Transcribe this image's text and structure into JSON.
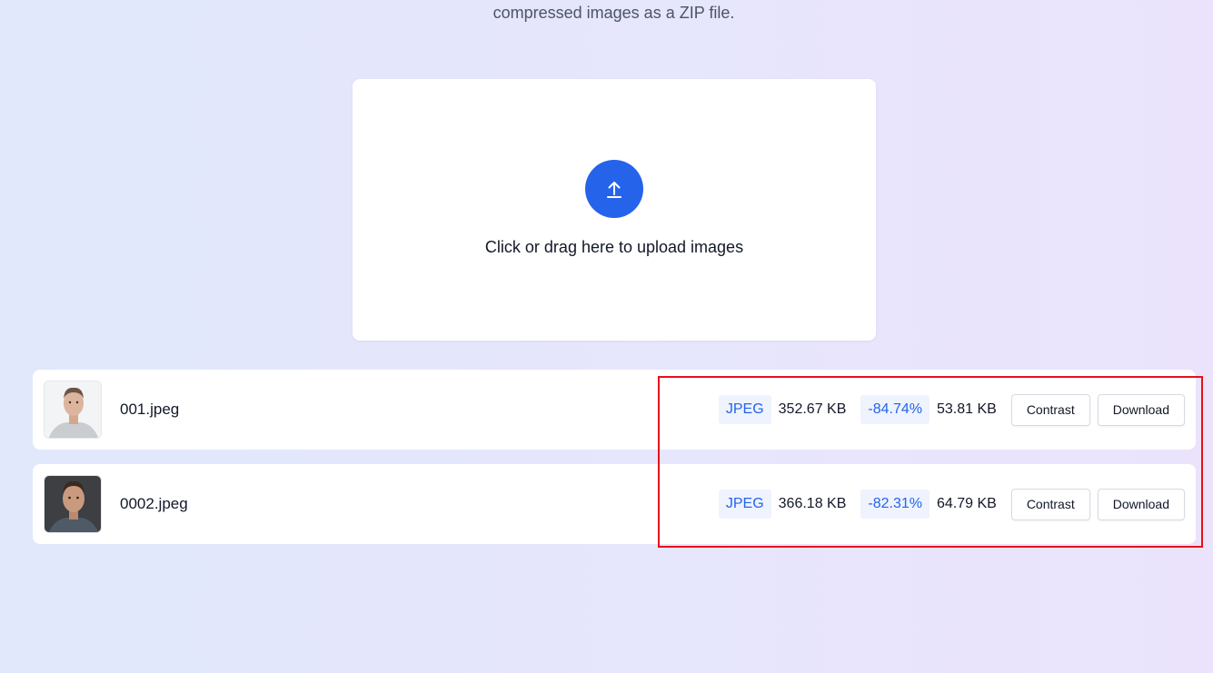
{
  "header": {
    "subtitle": "compressed images as a ZIP file."
  },
  "upload": {
    "icon": "upload-arrow-icon",
    "text": "Click or drag here to upload images",
    "accent_color": "#2563eb"
  },
  "files": [
    {
      "name": "001.jpeg",
      "format": "JPEG",
      "original_size": "352.67 KB",
      "ratio": "-84.74%",
      "compressed_size": "53.81 KB",
      "contrast_label": "Contrast",
      "download_label": "Download"
    },
    {
      "name": "0002.jpeg",
      "format": "JPEG",
      "original_size": "366.18 KB",
      "ratio": "-82.31%",
      "compressed_size": "64.79 KB",
      "contrast_label": "Contrast",
      "download_label": "Download"
    }
  ],
  "annotation": {
    "highlight_color": "#e8101c"
  }
}
